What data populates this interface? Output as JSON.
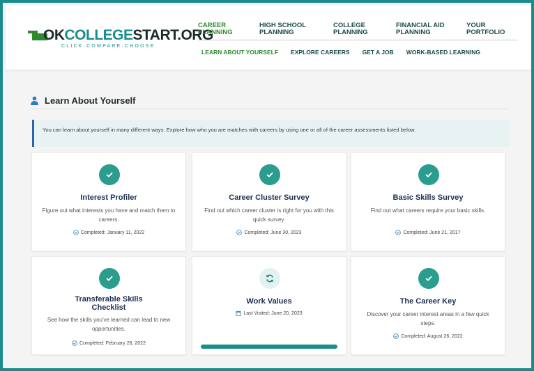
{
  "brand": {
    "logo_text_left": "OK",
    "logo_text_mid": "COLLEGE",
    "logo_text_right": "START.ORG",
    "tagline": "CLICK·COMPARE·CHOOSE",
    "accent": "#1a8c8c",
    "active_green": "#2f8a2f"
  },
  "topnav": [
    {
      "line1": "CAREER",
      "line2": "PLANNING",
      "active": true
    },
    {
      "line1": "HIGH SCHOOL",
      "line2": "PLANNING",
      "active": false
    },
    {
      "line1": "COLLEGE",
      "line2": "PLANNING",
      "active": false
    },
    {
      "line1": "FINANCIAL AID",
      "line2": "PLANNING",
      "active": false
    },
    {
      "line1": "YOUR",
      "line2": "PORTFOLIO",
      "active": false
    }
  ],
  "subnav": [
    "LEARN ABOUT YOURSELF",
    "EXPLORE CAREERS",
    "GET A JOB",
    "WORK-BASED LEARNING"
  ],
  "page": {
    "title": "Learn About Yourself",
    "title_icon": "person-icon",
    "intro": "You can learn about yourself in many different ways. Explore how who you are matches with careers by using one or all of the career assessments listed below."
  },
  "cards": [
    {
      "title": "Interest Profiler",
      "desc": "Figure out what interests you have and match them to careers.",
      "status": "Completed: January 11, 2022",
      "status_icon": "check-circle-icon",
      "icon": "check-icon"
    },
    {
      "title": "Career Cluster Survey",
      "desc": "Find out which career cluster is right for you with this quick survey.",
      "status": "Completed: June 30, 2023",
      "status_icon": "check-circle-icon",
      "icon": "check-icon"
    },
    {
      "title": "Basic Skills Survey",
      "desc": "Find out what careers require your basic skills.",
      "status": "Completed: June 21, 2017",
      "status_icon": "check-circle-icon",
      "icon": "check-icon"
    },
    {
      "title": "Transferable Skills Checklist",
      "desc": "See how the skills you've learned can lead to new opportunities.",
      "status": "Completed: February 28, 2022",
      "status_icon": "check-circle-icon",
      "icon": "check-icon"
    },
    {
      "title": "Work Values",
      "desc": "",
      "status": "Last Visited: June 20, 2023",
      "status_icon": "calendar-icon",
      "icon": "refresh-icon",
      "progress": 1.0
    },
    {
      "title": "The Career Key",
      "desc": "Discover your career interest areas in a few quick steps.",
      "status": "Completed: August 26, 2022",
      "status_icon": "check-circle-icon",
      "icon": "check-icon"
    }
  ]
}
